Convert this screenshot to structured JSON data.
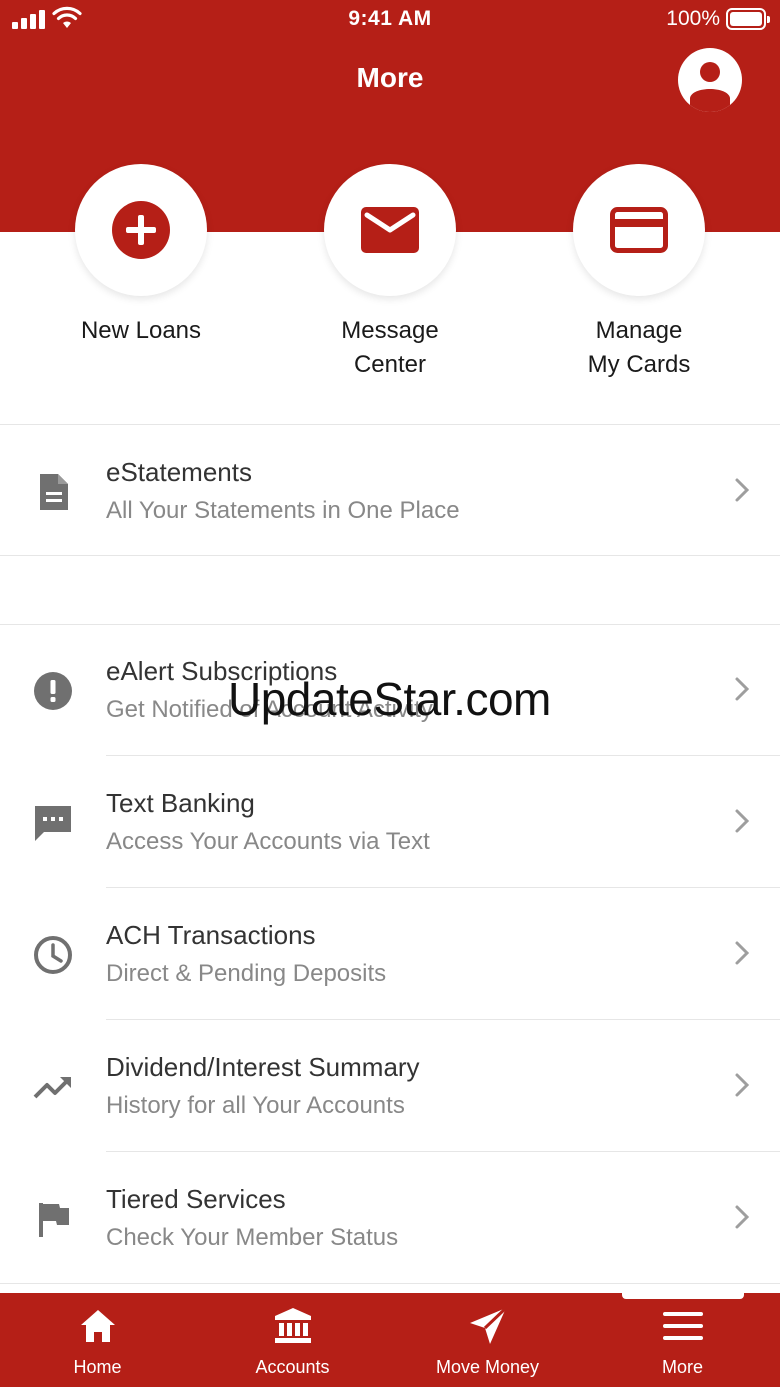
{
  "status_bar": {
    "time": "9:41 AM",
    "battery": "100%"
  },
  "header": {
    "title": "More"
  },
  "quick_actions": [
    {
      "label": "New Loans"
    },
    {
      "label": "Message\nCenter"
    },
    {
      "label": "Manage\nMy Cards"
    }
  ],
  "menu": [
    {
      "title": "eStatements",
      "subtitle": "All Your Statements in One Place"
    },
    {
      "title": "eAlert Subscriptions",
      "subtitle": "Get Notified of Account Activity"
    },
    {
      "title": "Text Banking",
      "subtitle": "Access Your Accounts via Text"
    },
    {
      "title": "ACH Transactions",
      "subtitle": "Direct & Pending Deposits"
    },
    {
      "title": "Dividend/Interest Summary",
      "subtitle": "History for all Your Accounts"
    },
    {
      "title": "Tiered Services",
      "subtitle": "Check Your Member Status"
    }
  ],
  "watermark": "UpdateStar.com",
  "tabs": [
    {
      "label": "Home"
    },
    {
      "label": "Accounts"
    },
    {
      "label": "Move Money"
    },
    {
      "label": "More"
    }
  ],
  "colors": {
    "brand": "#b51f17",
    "icon_grey": "#707070",
    "subtitle_grey": "#888888"
  },
  "icons": [
    "plus-circle-icon",
    "envelope-icon",
    "credit-card-icon",
    "document-icon",
    "alert-icon",
    "chat-icon",
    "clock-icon",
    "trending-up-icon",
    "flag-icon",
    "home-icon",
    "bank-icon",
    "send-icon",
    "menu-icon",
    "user-icon"
  ]
}
